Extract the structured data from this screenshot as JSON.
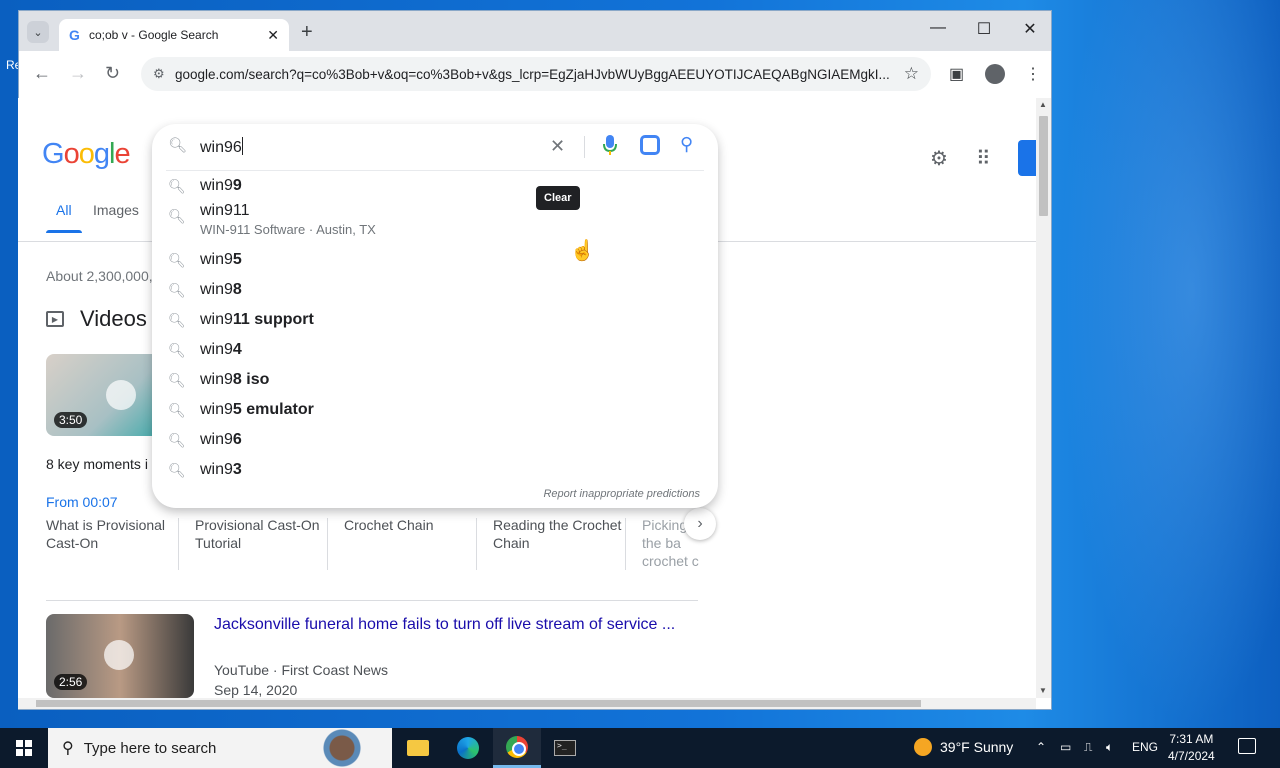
{
  "desktop": {
    "edge_text": "Re"
  },
  "browser": {
    "tab_title": "co;ob v - Google Search",
    "tab_favicon": "G",
    "url": "google.com/search?q=co%3Bob+v&oq=co%3Bob+v&gs_lcrp=EgZjaHJvbWUyBggAEEUYOTIJCAEQABgNGIAEMgkI...",
    "new_tab": "+",
    "controls": {
      "minimize": "—",
      "maximize": "☐",
      "close": "✕"
    }
  },
  "google": {
    "logo": [
      "G",
      "o",
      "o",
      "g",
      "l",
      "e"
    ],
    "search_query": "win96",
    "clear_tooltip": "Clear",
    "tabs": [
      "All",
      "Images"
    ],
    "result_stats": "About 2,300,000,",
    "videos_heading": "Videos",
    "video1_duration": "3:50",
    "key_moments": "8 key moments i",
    "from_time": "From 00:07",
    "moments": [
      "What is Provisional Cast-On",
      "Provisional Cast-On Tutorial",
      "Crochet Chain",
      "Reading the Crochet Chain",
      "Picking in the ba crochet c"
    ],
    "result": {
      "title": "Jacksonville funeral home fails to turn off live stream of service ...",
      "source": "YouTube · First Coast News",
      "date": "Sep 14, 2020",
      "duration": "2:56"
    },
    "suggestions": [
      {
        "prefix": "win9",
        "bold": "9",
        "sub": ""
      },
      {
        "prefix": "win911",
        "bold": "",
        "sub": "WIN-911 Software · Austin, TX"
      },
      {
        "prefix": "win9",
        "bold": "5",
        "sub": ""
      },
      {
        "prefix": "win9",
        "bold": "8",
        "sub": ""
      },
      {
        "prefix": "win9",
        "bold": "11 support",
        "sub": ""
      },
      {
        "prefix": "win9",
        "bold": "4",
        "sub": ""
      },
      {
        "prefix": "win9",
        "bold": "8 iso",
        "sub": ""
      },
      {
        "prefix": "win9",
        "bold": "5 emulator",
        "sub": ""
      },
      {
        "prefix": "win9",
        "bold": "6",
        "sub": ""
      },
      {
        "prefix": "win9",
        "bold": "3",
        "sub": ""
      }
    ],
    "report_text": "Report inappropriate predictions"
  },
  "taskbar": {
    "search_placeholder": "Type here to search",
    "weather": "39°F  Sunny",
    "language": "ENG",
    "time": "7:31 AM",
    "date": "4/7/2024"
  },
  "colors": {
    "accent": "#1a73e8",
    "link": "#1a0dab",
    "taskbar": "#0c1a2c"
  }
}
